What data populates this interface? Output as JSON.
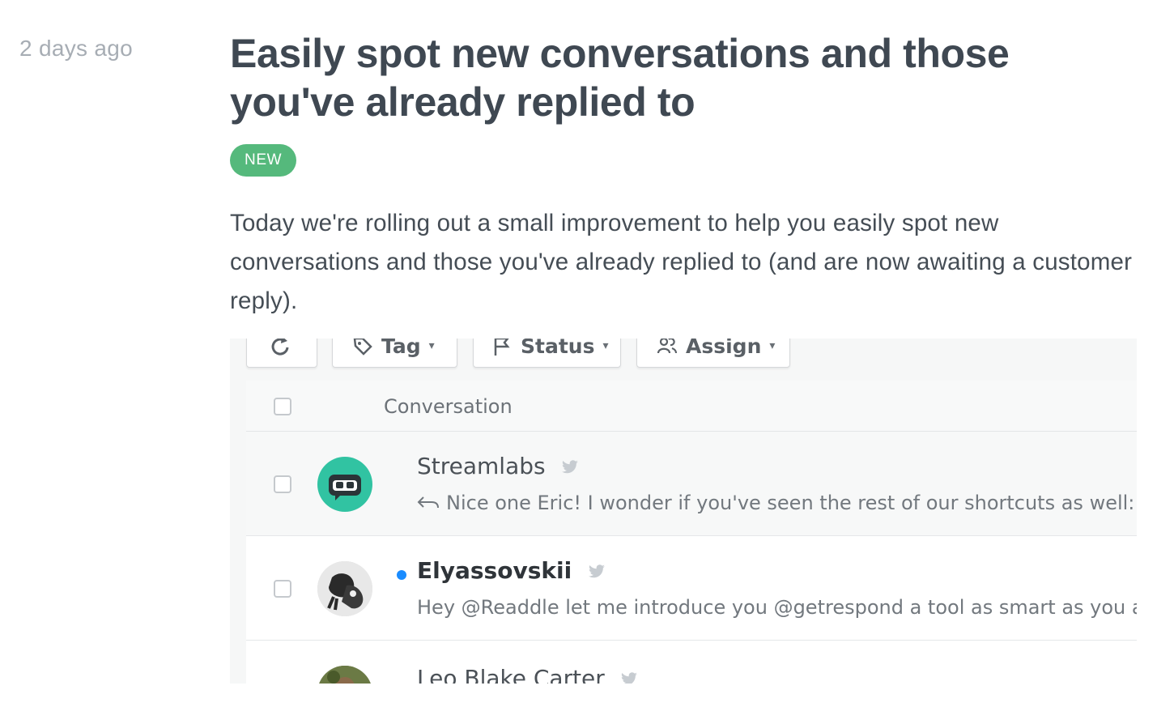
{
  "post": {
    "date": "2 days ago",
    "title": "Easily spot new conversations and those you've already replied to",
    "badge": "NEW",
    "body": "Today we're rolling out a small improvement to help you easily spot new conversations and those you've already replied to (and are now awaiting a customer reply)."
  },
  "screenshot": {
    "toolbar": {
      "tag_label": "Tag",
      "status_label": "Status",
      "assign_label": "Assign"
    },
    "table": {
      "column_header": "Conversation",
      "rows": [
        {
          "sender": "Streamlabs",
          "channel_icon": "twitter-icon",
          "preview": "Nice one Eric! I wonder if you've seen the rest of our shortcuts as well: http",
          "status": "replied",
          "unread": false
        },
        {
          "sender": "Elyassovskii",
          "channel_icon": "twitter-icon",
          "preview": "Hey @Readdle let me introduce you @getrespond a tool as smart as you are t",
          "status": "new",
          "unread": true
        },
        {
          "sender": "Leo Blake Carter",
          "channel_icon": "twitter-icon",
          "preview": "",
          "status": "",
          "unread": false
        }
      ]
    },
    "colors": {
      "badge": "#55b97c",
      "unread_dot": "#1a8cff",
      "streamlabs_avatar": "#31c3a2"
    }
  }
}
